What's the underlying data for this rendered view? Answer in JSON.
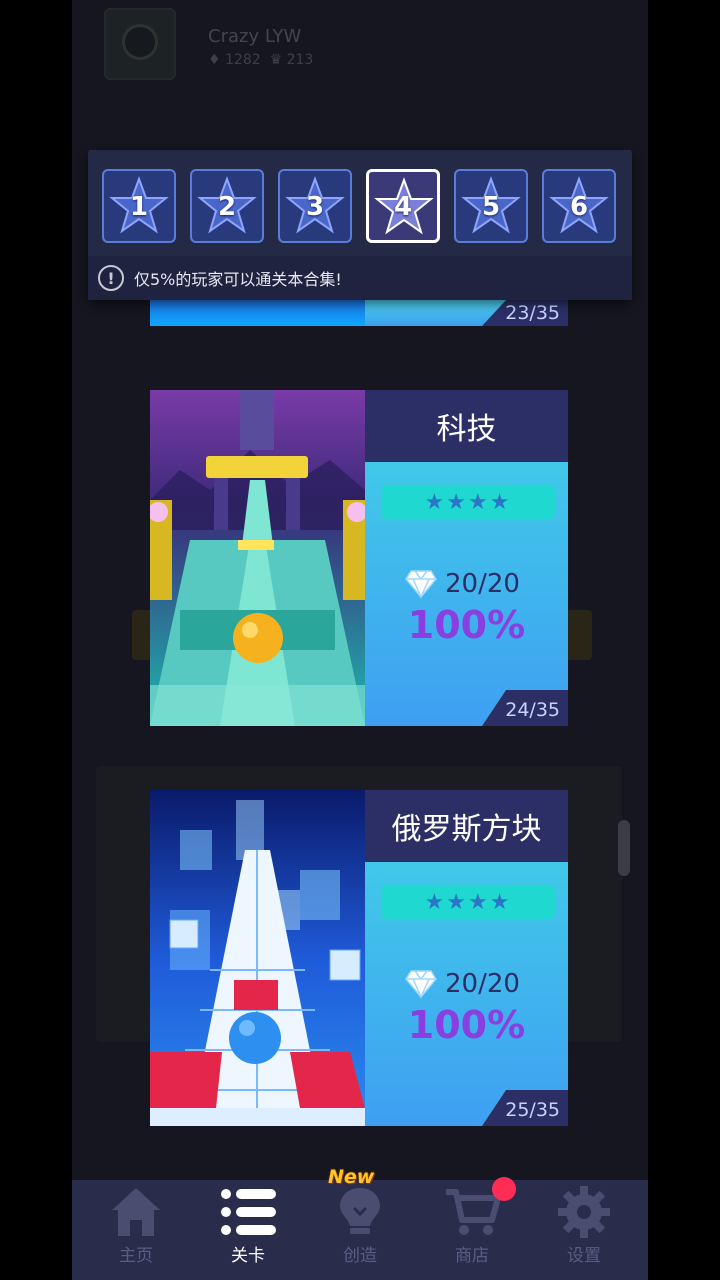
{
  "profile": {
    "name": "Crazy LYW",
    "gems": "1282",
    "crowns": "213"
  },
  "selector": {
    "tabs": [
      {
        "number": "1",
        "active": false
      },
      {
        "number": "2",
        "active": false
      },
      {
        "number": "3",
        "active": false
      },
      {
        "number": "4",
        "active": true
      },
      {
        "number": "5",
        "active": false
      },
      {
        "number": "6",
        "active": false
      }
    ],
    "notice_icon": "!",
    "notice": "仅5%的玩家可以通关本合集!"
  },
  "levels": {
    "previous": {
      "progress": "23/35"
    },
    "items": [
      {
        "title": "科技",
        "stars": "★★★★",
        "gems": "20/20",
        "percent": "100%",
        "progress": "24/35"
      },
      {
        "title": "俄罗斯方块",
        "stars": "★★★★",
        "gems": "20/20",
        "percent": "100%",
        "progress": "25/35"
      }
    ]
  },
  "nav": {
    "items": [
      {
        "label": "主页",
        "icon": "home-icon"
      },
      {
        "label": "关卡",
        "icon": "list-icon"
      },
      {
        "label": "创造",
        "icon": "lightbulb-icon"
      },
      {
        "label": "商店",
        "icon": "cart-icon"
      },
      {
        "label": "设置",
        "icon": "gear-icon"
      }
    ],
    "active": "关卡",
    "new_badge": "New"
  },
  "colors": {
    "accent_purple": "#8a3fe0",
    "nav_bg": "#2a2c4c",
    "card_title_bg": "#2b2f66",
    "badge_red": "#ff2d55",
    "new_yellow": "#ffc527"
  }
}
